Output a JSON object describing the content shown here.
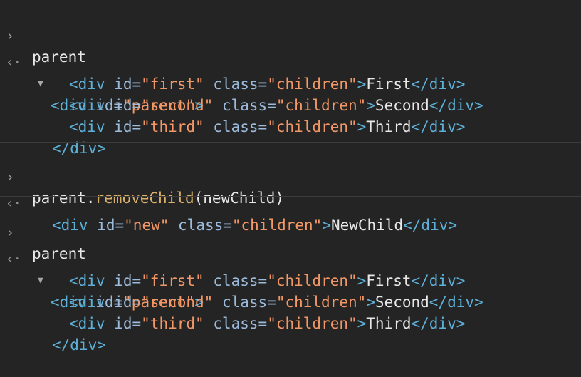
{
  "colors": {
    "background": "#242424",
    "tag": "#5db0d7",
    "attribute_name": "#9bbbdc",
    "attribute_value": "#f29766",
    "text": "#e8e8e8",
    "method": "#d9b16a",
    "divider": "#3b3b3b"
  },
  "icons": {
    "prompt": "›",
    "result": "‹·",
    "expand": "▼"
  },
  "entries": [
    {
      "input": {
        "text": "parent"
      },
      "output": {
        "open_tag": "<div ",
        "id_attr": "id=",
        "id_val": "\"parent\"",
        "close_bracket": ">",
        "children": [
          {
            "open": "<div ",
            "id_attr": "id=",
            "id_val": "\"first\"",
            "class_attr": "class=",
            "class_val": "\"children\"",
            "gt": ">",
            "text": "First",
            "close": "</div>"
          },
          {
            "open": "<div ",
            "id_attr": "id=",
            "id_val": "\"second\"",
            "class_attr": "class=",
            "class_val": "\"children\"",
            "gt": ">",
            "text": "Second",
            "close": "</div>"
          },
          {
            "open": "<div ",
            "id_attr": "id=",
            "id_val": "\"third\"",
            "class_attr": "class=",
            "class_val": "\"children\"",
            "gt": ">",
            "text": "Third",
            "close": "</div>"
          }
        ],
        "end_tag": "</div>"
      }
    },
    {
      "input": {
        "object": "parent.",
        "method": "removeChild",
        "args": "(newChild)"
      },
      "output": {
        "open": "<div ",
        "id_attr": "id=",
        "id_val": "\"new\"",
        "class_attr": "class=",
        "class_val": "\"children\"",
        "gt": ">",
        "text": "NewChild",
        "close": "</div>"
      }
    },
    {
      "input": {
        "text": "parent"
      },
      "output": {
        "open_tag": "<div ",
        "id_attr": "id=",
        "id_val": "\"parent\"",
        "close_bracket": ">",
        "children": [
          {
            "open": "<div ",
            "id_attr": "id=",
            "id_val": "\"first\"",
            "class_attr": "class=",
            "class_val": "\"children\"",
            "gt": ">",
            "text": "First",
            "close": "</div>"
          },
          {
            "open": "<div ",
            "id_attr": "id=",
            "id_val": "\"second\"",
            "class_attr": "class=",
            "class_val": "\"children\"",
            "gt": ">",
            "text": "Second",
            "close": "</div>"
          },
          {
            "open": "<div ",
            "id_attr": "id=",
            "id_val": "\"third\"",
            "class_attr": "class=",
            "class_val": "\"children\"",
            "gt": ">",
            "text": "Third",
            "close": "</div>"
          }
        ],
        "end_tag": "</div>"
      }
    }
  ]
}
